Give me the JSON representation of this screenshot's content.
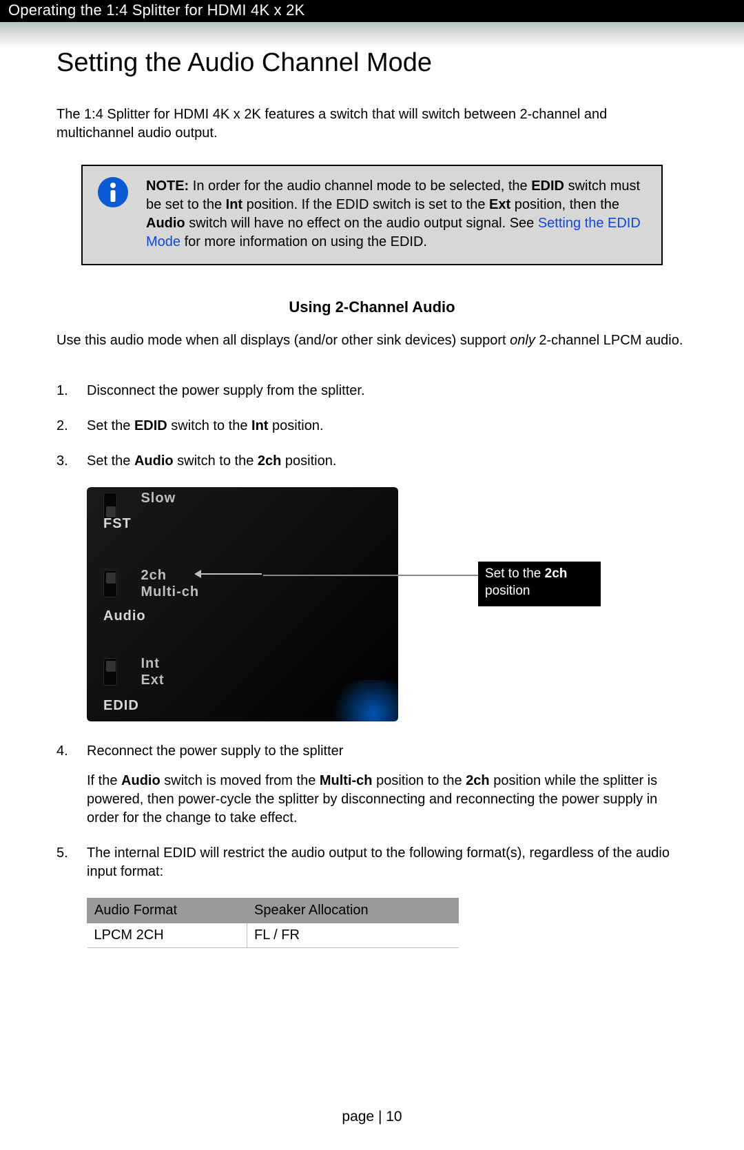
{
  "header": {
    "breadcrumb": "Operating the 1:4 Splitter for HDMI 4K x 2K"
  },
  "title": "Setting the Audio Channel Mode",
  "intro": "The 1:4 Splitter for HDMI 4K x 2K features a switch that will switch between 2-channel and multichannel audio output.",
  "note": {
    "label": "NOTE:",
    "part1": "  In order for the audio channel mode to be selected, the ",
    "b1": "EDID",
    "part2": " switch must be set to the ",
    "b2": "Int",
    "part3": " position.  If the EDID switch is set to the ",
    "b3": "Ext",
    "part4": " position, then the ",
    "b4": "Audio",
    "part5": " switch will have no effect on the audio output signal.  See ",
    "link": "Setting the EDID Mode",
    "part6": " for more information on using the EDID."
  },
  "subheading": "Using 2-Channel Audio",
  "lead": {
    "pre": "Use this audio mode when all displays (and/or other sink devices) support ",
    "only": "only",
    "post": " 2-channel LPCM audio."
  },
  "steps": {
    "s1": "Disconnect the power supply from the splitter.",
    "s2": {
      "pre": "Set the ",
      "b1": "EDID",
      "mid": " switch to the ",
      "b2": "Int",
      "post": " position."
    },
    "s3": {
      "pre": "Set the ",
      "b1": "Audio",
      "mid": " switch to the ",
      "b2": "2ch",
      "post": " position."
    },
    "s4": {
      "line1": "Reconnect the power supply to the splitter",
      "p": {
        "pre": "If the ",
        "b1": "Audio",
        "a": " switch is moved from the ",
        "b2": "Multi-ch",
        "b": " position to the ",
        "b3": "2ch",
        "c": " position while the splitter is powered, then power-cycle the splitter by disconnecting and reconnecting the power supply in order for the change to take effect."
      }
    },
    "s5": "The internal EDID will restrict the audio output to the following format(s), regardless of the audio input format:"
  },
  "device": {
    "slow_opt1": "Slow",
    "fst": "FST",
    "audio_opt1": "2ch",
    "audio_opt2": "Multi-ch",
    "audio_label": "Audio",
    "edid_opt1": "Int",
    "edid_opt2": "Ext",
    "edid_label": "EDID"
  },
  "callout": {
    "pre": "Set to the ",
    "b": "2ch",
    "post": " position"
  },
  "table": {
    "h1": "Audio Format",
    "h2": "Speaker Allocation",
    "r1c1": "LPCM 2CH",
    "r1c2": "FL / FR"
  },
  "footer": {
    "label": "page | ",
    "num": "10"
  }
}
